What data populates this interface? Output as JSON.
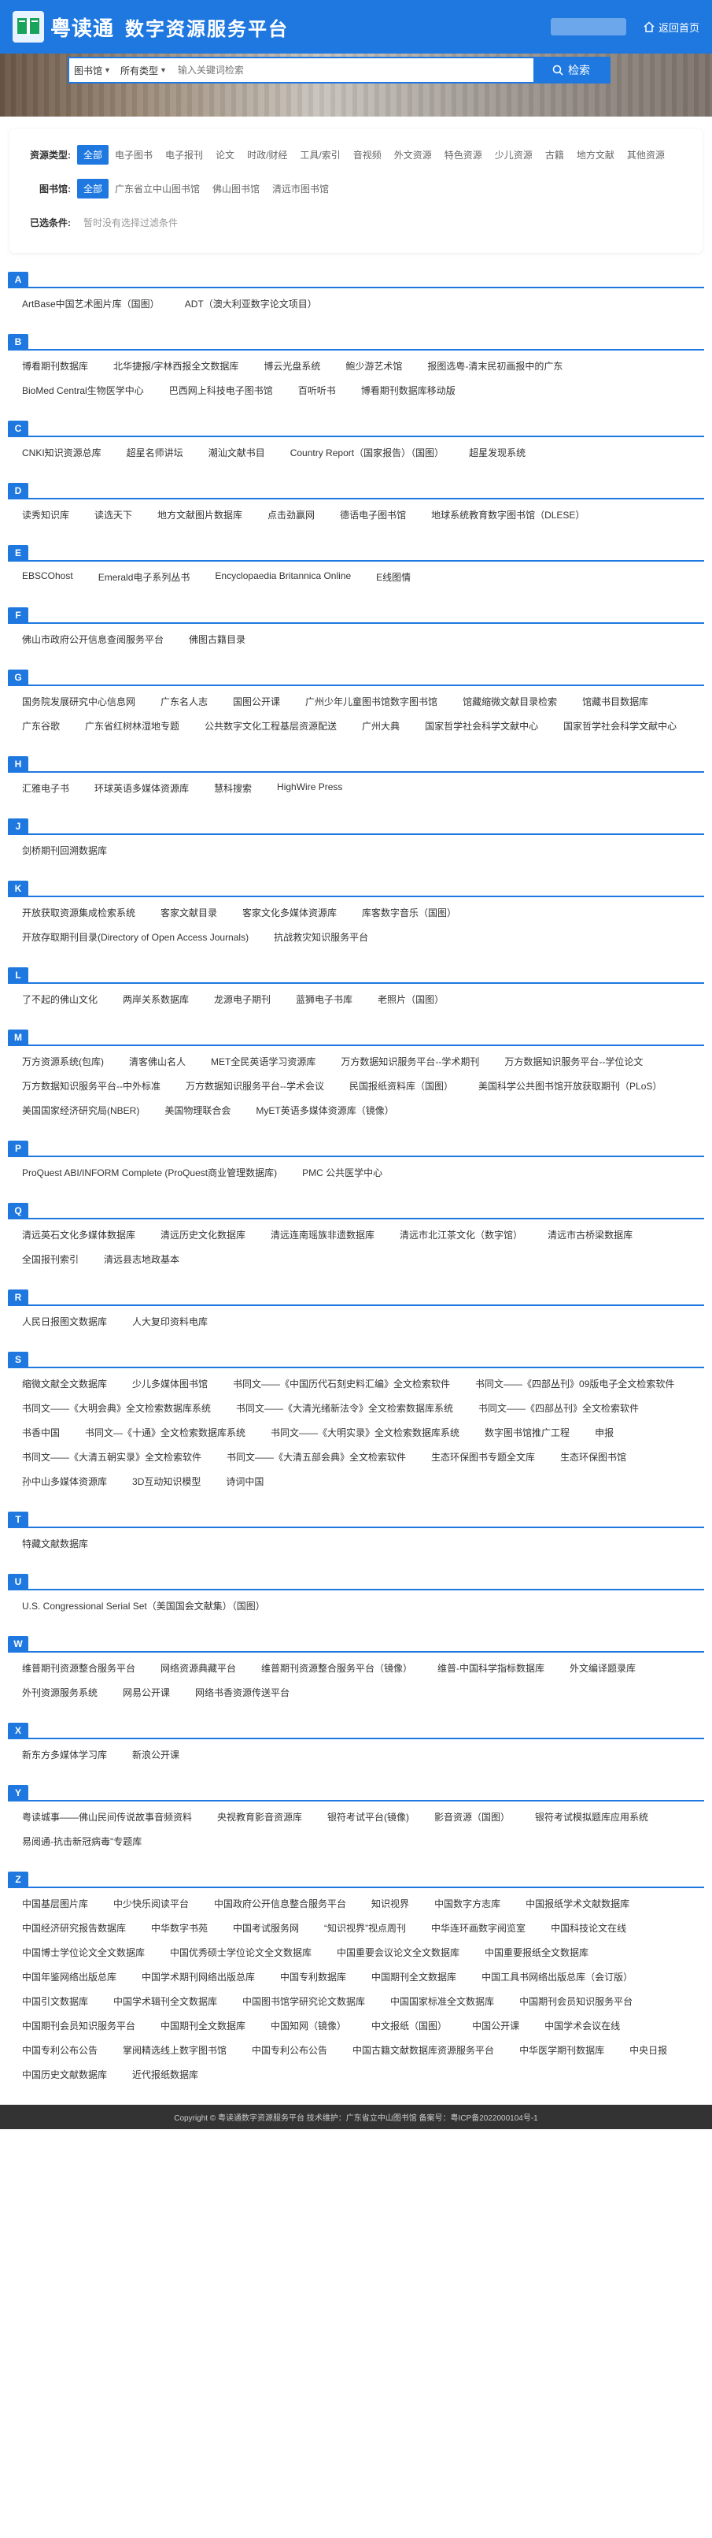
{
  "header": {
    "brand": "粤读通",
    "brand_sub": "数字资源服务平台",
    "home_label": "返回首页",
    "accent": "#1e78e0"
  },
  "search": {
    "library_select": "图书馆",
    "type_select": "所有类型",
    "placeholder": "输入关键词检索",
    "button": "检索"
  },
  "filters": {
    "resource_type": {
      "label": "资源类型:",
      "options": [
        "全部",
        "电子图书",
        "电子报刊",
        "论文",
        "时政/财经",
        "工具/索引",
        "音视频",
        "外文资源",
        "特色资源",
        "少儿资源",
        "古籍",
        "地方文献",
        "其他资源"
      ]
    },
    "library": {
      "label": "图书馆:",
      "options": [
        "全部",
        "广东省立中山图书馆",
        "佛山图书馆",
        "清远市图书馆"
      ]
    },
    "selected": {
      "label": "已选条件:",
      "value": "暂时没有选择过滤条件"
    }
  },
  "sections": [
    {
      "letter": "A",
      "items": [
        "ArtBase中国艺术图片库（国图）",
        "ADT（澳大利亚数字论文项目）"
      ]
    },
    {
      "letter": "B",
      "items": [
        "博看期刊数据库",
        "北华捷报/字林西报全文数据库",
        "博云光盘系统",
        "鲍少游艺术馆",
        "报图选粤-清末民初画报中的广东",
        "BioMed Central生物医学中心",
        "巴西网上科技电子图书馆",
        "百听听书",
        "博看期刊数据库移动版"
      ]
    },
    {
      "letter": "C",
      "items": [
        "CNKI知识资源总库",
        "超星名师讲坛",
        "潮汕文献书目",
        "Country Report（国家报告）（国图）",
        "超星发现系统"
      ]
    },
    {
      "letter": "D",
      "items": [
        "读秀知识库",
        "读选天下",
        "地方文献图片数据库",
        "点击劲赢网",
        "德语电子图书馆",
        "地球系统教育数字图书馆（DLESE）"
      ]
    },
    {
      "letter": "E",
      "items": [
        "EBSCOhost",
        "Emerald电子系列丛书",
        "Encyclopaedia Britannica Online",
        "E线图情"
      ]
    },
    {
      "letter": "F",
      "items": [
        "佛山市政府公开信息查阅服务平台",
        "佛图古籍目录"
      ]
    },
    {
      "letter": "G",
      "items": [
        "国务院发展研究中心信息网",
        "广东名人志",
        "国图公开课",
        "广州少年儿童图书馆数字图书馆",
        "馆藏缩微文献目录检索",
        "馆藏书目数据库",
        "广东谷歌",
        "广东省红树林湿地专题",
        "公共数字文化工程基层资源配送",
        "广州大典",
        "国家哲学社会科学文献中心",
        "国家哲学社会科学文献中心"
      ]
    },
    {
      "letter": "H",
      "items": [
        "汇雅电子书",
        "环球英语多媒体资源库",
        "慧科搜索",
        "HighWire Press"
      ]
    },
    {
      "letter": "J",
      "items": [
        "剑桥期刊回溯数据库"
      ]
    },
    {
      "letter": "K",
      "items": [
        "开放获取资源集成检索系统",
        "客家文献目录",
        "客家文化多媒体资源库",
        "库客数字音乐（国图）",
        "开放存取期刊目录(Directory of Open Access Journals)",
        "抗战救灾知识服务平台"
      ]
    },
    {
      "letter": "L",
      "items": [
        "了不起的佛山文化",
        "两岸关系数据库",
        "龙源电子期刊",
        "蓝狮电子书库",
        "老照片（国图）"
      ]
    },
    {
      "letter": "M",
      "items": [
        "万方资源系统(包库)",
        "清客佛山名人",
        "MET全民英语学习资源库",
        "万方数据知识服务平台--学术期刊",
        "万方数据知识服务平台--学位论文",
        "万方数据知识服务平台--中外标准",
        "万方数据知识服务平台--学术会议",
        "民国报纸资料库（国图）",
        "美国科学公共图书馆开放获取期刊（PLoS）",
        "美国国家经济研究局(NBER)",
        "美国物理联合会",
        "MyET英语多媒体资源库（镜像）"
      ]
    },
    {
      "letter": "P",
      "items": [
        "ProQuest ABI/INFORM Complete (ProQuest商业管理数据库)",
        "PMC 公共医学中心"
      ]
    },
    {
      "letter": "Q",
      "items": [
        "清远英石文化多媒体数据库",
        "清远历史文化数据库",
        "清远连南瑶族非遗数据库",
        "清远市北江茶文化（数字馆）",
        "清远市古桥梁数据库",
        "全国报刊索引",
        "清远县志地政基本"
      ]
    },
    {
      "letter": "R",
      "items": [
        "人民日报图文数据库",
        "人大复印资料电库"
      ]
    },
    {
      "letter": "S",
      "items": [
        "缩微文献全文数据库",
        "少儿多媒体图书馆",
        "书同文——《中国历代石刻史料汇编》全文检索软件",
        "书同文——《四部丛刊》09版电子全文检索软件",
        "书同文——《大明会典》全文检索数据库系统",
        "书同文——《大清光绪新法令》全文检索数据库系统",
        "书同文——《四部丛刊》全文检索软件",
        "书香中国",
        "书同文—《十通》全文检索数据库系统",
        "书同文——《大明实录》全文检索数据库系统",
        "数字图书馆推广工程",
        "申报",
        "书同文——《大清五朝实录》全文检索软件",
        "书同文——《大清五部会典》全文检索软件",
        "生态环保图书专题全文库",
        "生态环保图书馆",
        "孙中山多媒体资源库",
        "3D互动知识模型",
        "诗词中国"
      ]
    },
    {
      "letter": "T",
      "items": [
        "特藏文献数据库"
      ]
    },
    {
      "letter": "U",
      "items": [
        "U.S. Congressional Serial Set（美国国会文献集）（国图）"
      ]
    },
    {
      "letter": "W",
      "items": [
        "维普期刊资源整合服务平台",
        "网络资源典藏平台",
        "维普期刊资源整合服务平台（镜像）",
        "维普-中国科学指标数据库",
        "外文编译题录库",
        "外刊资源服务系统",
        "网易公开课",
        "网络书香资源传送平台"
      ]
    },
    {
      "letter": "X",
      "items": [
        "新东方多媒体学习库",
        "新浪公开课"
      ]
    },
    {
      "letter": "Y",
      "items": [
        "粤读城事——佛山民间传说故事音频资料",
        "央视教育影音资源库",
        "银符考试平台(镜像)",
        "影音资源（国图）",
        "银符考试模拟题库应用系统",
        "易阅通-抗击新冠病毒\"专题库"
      ]
    },
    {
      "letter": "Z",
      "items": [
        "中国基层图片库",
        "中少快乐阅读平台",
        "中国政府公开信息整合服务平台",
        "知识视界",
        "中国数字方志库",
        "中国报纸学术文献数据库",
        "中国经济研究报告数据库",
        "中华数字书苑",
        "中国考试服务网",
        "“知识视界”视点周刊",
        "中华连环画数字阅览室",
        "中国科技论文在线",
        "中国博士学位论文全文数据库",
        "中国优秀硕士学位论文全文数据库",
        "中国重要会议论文全文数据库",
        "中国重要报纸全文数据库",
        "中国年鉴网络出版总库",
        "中国学术期刊网络出版总库",
        "中国专利数据库",
        "中国期刊全文数据库",
        "中国工具书网络出版总库（会订版）",
        "中国引文数据库",
        "中国学术辑刊全文数据库",
        "中国图书馆学研究论文数据库",
        "中国国家标准全文数据库",
        "中国期刊会员知识服务平台",
        "中国期刊会员知识服务平台",
        "中国期刊全文数据库",
        "中国知网（镜像）",
        "中文报纸（国图）",
        "中国公开课",
        "中国学术会议在线",
        "中国专利公布公告",
        "掌阅精选线上数字图书馆",
        "中国专利公布公告",
        "中国古籍文献数据库资源服务平台",
        "中华医学期刊数据库",
        "中央日报",
        "中国历史文献数据库",
        "近代报纸数据库"
      ]
    }
  ],
  "footer": {
    "text": "Copyright © 粤读通数字资源服务平台 技术维护：广东省立中山图书馆 备案号：粤ICP备2022000104号-1"
  }
}
